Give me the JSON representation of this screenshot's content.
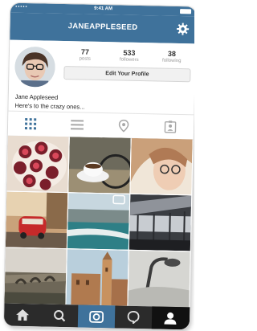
{
  "status_bar": {
    "carrier": "•••••",
    "time": "9:41 AM"
  },
  "header": {
    "title": "JANEAPPLESEED"
  },
  "stats": [
    {
      "value": "77",
      "label": "posts"
    },
    {
      "value": "533",
      "label": "followers"
    },
    {
      "value": "38",
      "label": "following"
    }
  ],
  "profile": {
    "edit_label": "Edit Your Profile",
    "name": "Jane Appleseed",
    "bio": "Here's to the crazy ones..."
  },
  "view_tabs": [
    "grid-icon",
    "list-icon",
    "location-pin-icon",
    "tagged-photos-icon"
  ],
  "photos": [
    "figs on plate",
    "coffee cup by bicycle",
    "woman with glasses",
    "red car on street",
    "swimming pool by sea",
    "airport terminal",
    "stone bridge",
    "castle tower",
    "street lamp"
  ],
  "bottom_nav": [
    "home-icon",
    "search-icon",
    "camera-icon",
    "activity-icon",
    "profile-icon"
  ],
  "colors": {
    "accent": "#3f729b",
    "tab_bar": "#2b2b2b",
    "button_bg": "#f1f1f1"
  }
}
